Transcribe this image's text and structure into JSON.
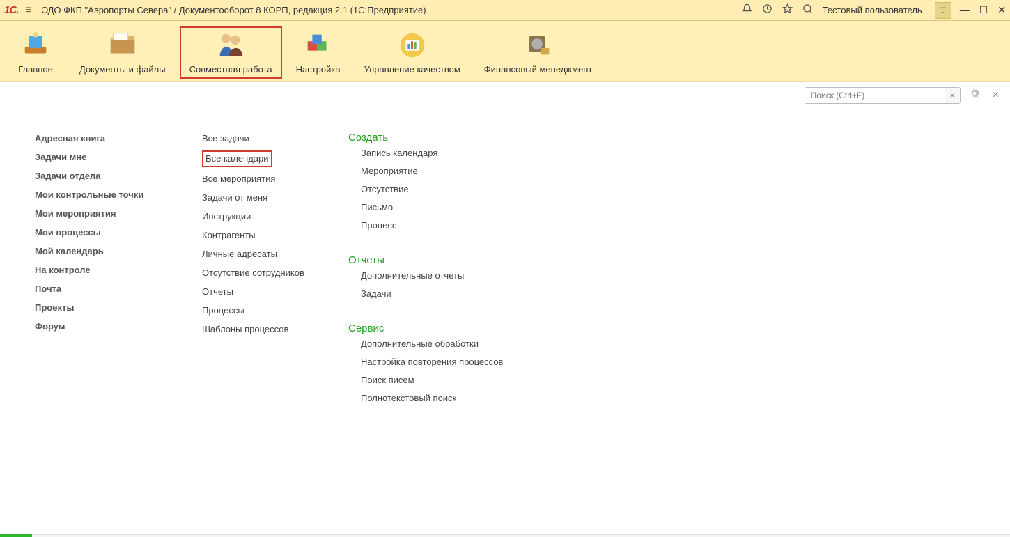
{
  "titlebar": {
    "title": "ЭДО ФКП \"Аэропорты Севера\" / Документооборот 8 КОРП, редакция 2.1  (1С:Предприятие)",
    "user": "Тестовый пользователь"
  },
  "sections": [
    {
      "label": "Главное"
    },
    {
      "label": "Документы и файлы"
    },
    {
      "label": "Совместная работа"
    },
    {
      "label": "Настройка"
    },
    {
      "label": "Управление качеством"
    },
    {
      "label": "Финансовый менеджмент"
    }
  ],
  "search": {
    "placeholder": "Поиск (Ctrl+F)"
  },
  "col1": [
    "Адресная книга",
    "Задачи мне",
    "Задачи отдела",
    "Мои контрольные точки",
    "Мои мероприятия",
    "Мои процессы",
    "Мой календарь",
    "На контроле",
    "Почта",
    "Проекты",
    "Форум"
  ],
  "col2": [
    "Все задачи",
    "Все календари",
    "Все мероприятия",
    "Задачи от меня",
    "Инструкции",
    "Контрагенты",
    "Личные адресаты",
    "Отсутствие сотрудников",
    "Отчеты",
    "Процессы",
    "Шаблоны процессов"
  ],
  "groups": [
    {
      "head": "Создать",
      "items": [
        "Запись календаря",
        "Мероприятие",
        "Отсутствие",
        "Письмо",
        "Процесс"
      ]
    },
    {
      "head": "Отчеты",
      "items": [
        "Дополнительные отчеты",
        "Задачи"
      ]
    },
    {
      "head": "Сервис",
      "items": [
        "Дополнительные обработки",
        "Настройка повторения процессов",
        "Поиск писем",
        "Полнотекстовый поиск"
      ]
    }
  ]
}
